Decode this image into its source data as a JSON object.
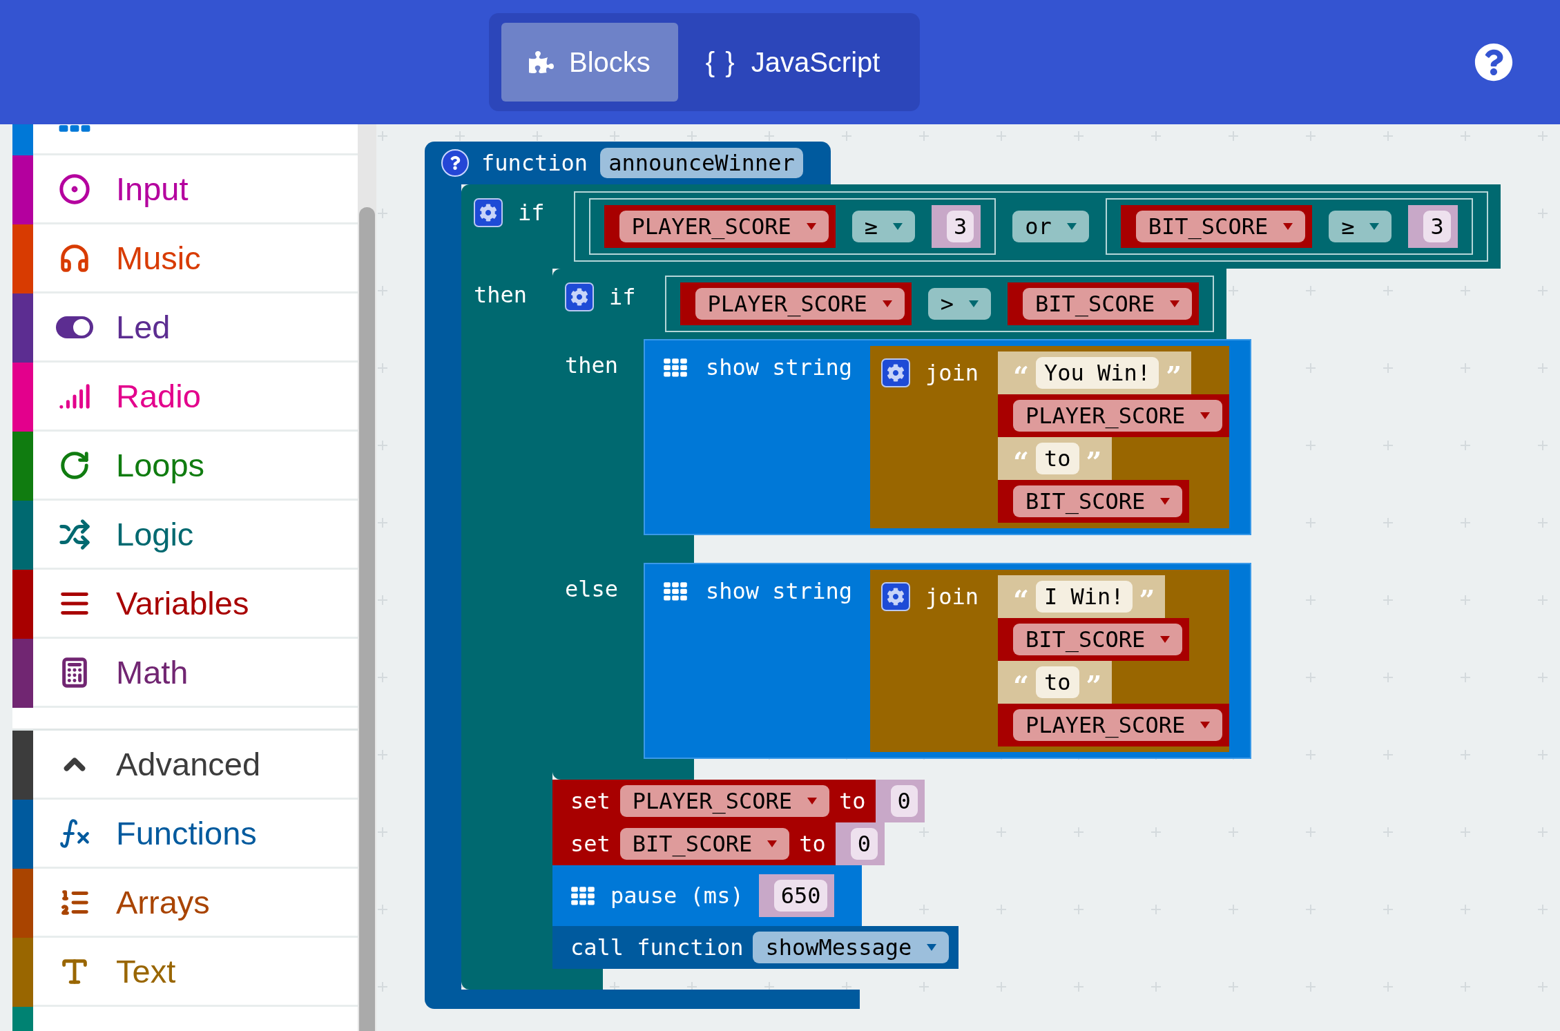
{
  "header": {
    "tabs": [
      {
        "kind": "blocks",
        "label": "Blocks",
        "selected": true
      },
      {
        "kind": "code",
        "glyph": "{ }",
        "label": "JavaScript",
        "selected": false
      }
    ]
  },
  "sidebar": {
    "items": [
      {
        "kind": "basic",
        "color": "#0078d7"
      },
      {
        "kind": "input",
        "label": "Input",
        "color": "#b4009e"
      },
      {
        "kind": "music",
        "label": "Music",
        "color": "#d83b01"
      },
      {
        "kind": "led",
        "label": "Led",
        "color": "#5c2d91"
      },
      {
        "kind": "radio",
        "label": "Radio",
        "color": "#e3008c"
      },
      {
        "kind": "loops",
        "label": "Loops",
        "color": "#107c10"
      },
      {
        "kind": "logic",
        "label": "Logic",
        "color": "#006970"
      },
      {
        "kind": "variables",
        "label": "Variables",
        "color": "#a80000"
      },
      {
        "kind": "math",
        "label": "Math",
        "color": "#712672"
      }
    ],
    "advanced": {
      "label": "Advanced",
      "expanded": true,
      "color": "#3c3c3c"
    },
    "advanced_items": [
      {
        "kind": "functions",
        "label": "Functions",
        "color": "#005a9e"
      },
      {
        "kind": "arrays",
        "label": "Arrays",
        "color": "#a94400"
      },
      {
        "kind": "text",
        "label": "Text",
        "color": "#996600"
      },
      {
        "kind": "cut",
        "color": "#008272"
      }
    ]
  },
  "workspace": {
    "block": {
      "kind": "function",
      "label": "function",
      "name": "announceWinner",
      "body": [
        {
          "kind": "if",
          "label": "if",
          "then_label": "then",
          "condition": {
            "kind": "or",
            "op": "or",
            "left": {
              "kind": "compare",
              "left": {
                "kind": "variable",
                "name": "PLAYER_SCORE"
              },
              "op": "≥",
              "right": {
                "kind": "number",
                "value": "3"
              }
            },
            "right": {
              "kind": "compare",
              "left": {
                "kind": "variable",
                "name": "BIT_SCORE"
              },
              "op": "≥",
              "right": {
                "kind": "number",
                "value": "3"
              }
            }
          },
          "then": [
            {
              "kind": "if",
              "label": "if",
              "then_label": "then",
              "else_label": "else",
              "condition": {
                "kind": "compare",
                "left": {
                  "kind": "variable",
                  "name": "PLAYER_SCORE"
                },
                "op": ">",
                "right": {
                  "kind": "variable",
                  "name": "BIT_SCORE"
                }
              },
              "then": [
                {
                  "kind": "show_string",
                  "label": "show string",
                  "value": {
                    "kind": "join",
                    "label": "join",
                    "items": [
                      {
                        "kind": "text",
                        "open": "“",
                        "value": "You Win!",
                        "close": "”"
                      },
                      {
                        "kind": "variable",
                        "name": "PLAYER_SCORE"
                      },
                      {
                        "kind": "text",
                        "open": "“",
                        "value": "to",
                        "close": "”"
                      },
                      {
                        "kind": "variable",
                        "name": "BIT_SCORE"
                      }
                    ]
                  }
                }
              ],
              "else": [
                {
                  "kind": "show_string",
                  "label": "show string",
                  "value": {
                    "kind": "join",
                    "label": "join",
                    "items": [
                      {
                        "kind": "text",
                        "open": "“",
                        "value": "I Win!",
                        "close": "”"
                      },
                      {
                        "kind": "variable",
                        "name": "BIT_SCORE"
                      },
                      {
                        "kind": "text",
                        "open": "“",
                        "value": "to",
                        "close": "”"
                      },
                      {
                        "kind": "variable",
                        "name": "PLAYER_SCORE"
                      }
                    ]
                  }
                }
              ]
            },
            {
              "kind": "set",
              "label": "set",
              "variable": "PLAYER_SCORE",
              "to_label": "to",
              "value": {
                "kind": "number",
                "value": "0"
              }
            },
            {
              "kind": "set",
              "label": "set",
              "variable": "BIT_SCORE",
              "to_label": "to",
              "value": {
                "kind": "number",
                "value": "0"
              }
            },
            {
              "kind": "pause",
              "label": "pause (ms)",
              "value": {
                "kind": "number",
                "value": "650"
              }
            },
            {
              "kind": "call",
              "label": "call function",
              "name": "showMessage"
            }
          ]
        }
      ]
    }
  }
}
